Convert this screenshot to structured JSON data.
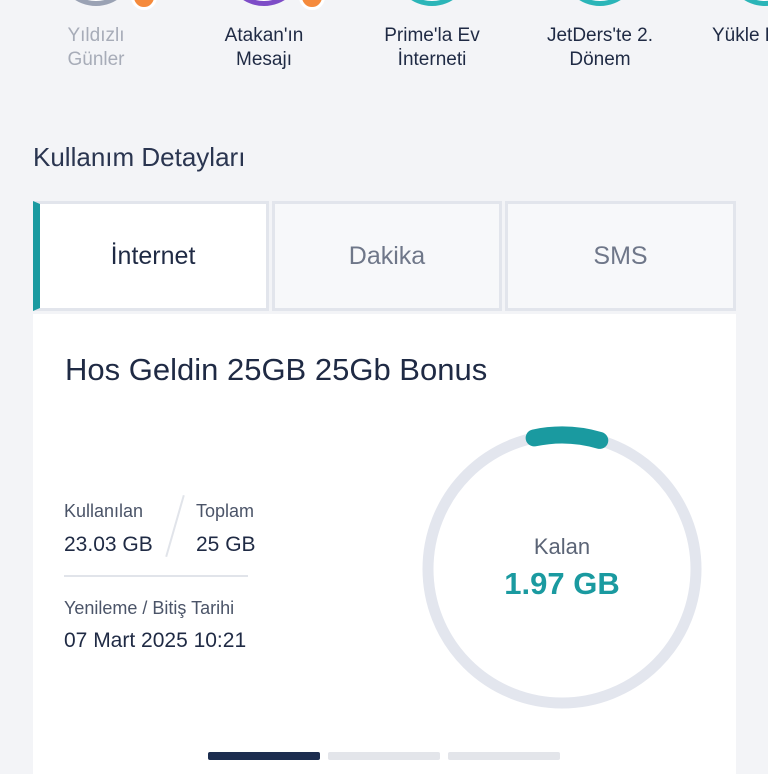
{
  "stories": [
    {
      "label": "Yıldızlı\nGünler",
      "muted": true
    },
    {
      "label": "Atakan'ın\nMesajı",
      "muted": false
    },
    {
      "label": "Prime'la Ev\nİnterneti",
      "muted": false
    },
    {
      "label": "JetDers'te 2.\nDönem",
      "muted": false
    },
    {
      "label": "Yükle K",
      "muted": false
    }
  ],
  "section_title": "Kullanım Detayları",
  "tabs": [
    {
      "label": "İnternet",
      "active": true
    },
    {
      "label": "Dakika",
      "active": false
    },
    {
      "label": "SMS",
      "active": false
    }
  ],
  "package": {
    "title": "Hos Geldin 25GB 25Gb Bonus",
    "used_label": "Kullanılan",
    "used_value": "23.03 GB",
    "total_label": "Toplam",
    "total_value": "25 GB",
    "renewal_label": "Yenileme / Bitiş Tarihi",
    "renewal_value": "07 Mart 2025 10:21",
    "remaining_label": "Kalan",
    "remaining_value": "1.97 GB",
    "remaining_fraction": 0.0788
  },
  "pager": {
    "count": 3,
    "active_index": 0
  },
  "colors": {
    "accent": "#1a9aa0",
    "ring_track": "#e3e6ee",
    "pager_active": "#1c2d4f"
  }
}
